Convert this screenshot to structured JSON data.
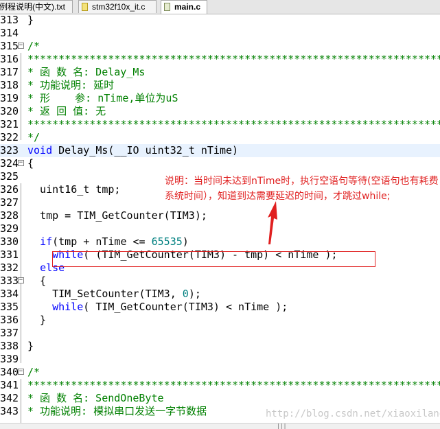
{
  "tabs": [
    {
      "label": "例程说明(中文).txt",
      "icon": "text-file-icon",
      "active": false
    },
    {
      "label": "stm32f10x_it.c",
      "icon": "c-file-icon",
      "active": false
    },
    {
      "label": "main.c",
      "icon": "c-file-icon",
      "active": true
    }
  ],
  "lines": [
    {
      "num": "313",
      "code": "}"
    },
    {
      "num": "314",
      "code": ""
    },
    {
      "num": "315",
      "code": "/*"
    },
    {
      "num": "316",
      "code": "*************************************************************************"
    },
    {
      "num": "317",
      "code": "* 函 数 名: Delay_Ms"
    },
    {
      "num": "318",
      "code": "* 功能说明: 延时"
    },
    {
      "num": "319",
      "code": "* 形    参: nTime,单位为uS"
    },
    {
      "num": "320",
      "code": "* 返 回 值: 无"
    },
    {
      "num": "321",
      "code": "*************************************************************************"
    },
    {
      "num": "322",
      "code": "*/"
    },
    {
      "num": "323",
      "code": "void Delay_Ms(__IO uint32_t nTime)"
    },
    {
      "num": "324",
      "code": "{"
    },
    {
      "num": "325",
      "code": ""
    },
    {
      "num": "326",
      "code": "  uint16_t tmp;"
    },
    {
      "num": "327",
      "code": ""
    },
    {
      "num": "328",
      "code": "  tmp = TIM_GetCounter(TIM3);"
    },
    {
      "num": "329",
      "code": ""
    },
    {
      "num": "330",
      "code": "  if(tmp + nTime <= 65535)"
    },
    {
      "num": "331",
      "code": "    while( (TIM_GetCounter(TIM3) - tmp) < nTime );"
    },
    {
      "num": "332",
      "code": "  else"
    },
    {
      "num": "333",
      "code": "  {"
    },
    {
      "num": "334",
      "code": "    TIM_SetCounter(TIM3, 0);"
    },
    {
      "num": "335",
      "code": "    while( TIM_GetCounter(TIM3) < nTime );"
    },
    {
      "num": "336",
      "code": "  }"
    },
    {
      "num": "337",
      "code": ""
    },
    {
      "num": "338",
      "code": "}"
    },
    {
      "num": "339",
      "code": ""
    },
    {
      "num": "340",
      "code": "/*"
    },
    {
      "num": "341",
      "code": "*************************************************************************"
    },
    {
      "num": "342",
      "code": "* 函 数 名: SendOneByte"
    },
    {
      "num": "343",
      "code": "* 功能说明: 模拟串口发送一字节数据"
    }
  ],
  "annotation": "说明：当时间未达到nTime时，执行空语句等待(空语句也有耗费系统时间），知道到达需要延迟的时间，才跳过while;",
  "watermark": "http://blog.csdn.net/xiaoxilang",
  "colors": {
    "comment": "#008000",
    "keyword": "#0000ff",
    "number": "#008080",
    "annotation": "#e02020"
  }
}
